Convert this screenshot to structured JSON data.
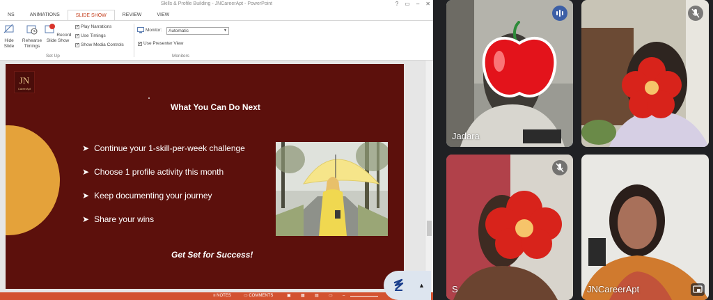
{
  "ppt": {
    "title": "Skills & Profile Building - JNCareerApt - PowerPoint",
    "tabs": [
      {
        "label": "NS"
      },
      {
        "label": "ANIMATIONS"
      },
      {
        "label": "SLIDE SHOW",
        "active": true
      },
      {
        "label": "REVIEW"
      },
      {
        "label": "VIEW"
      }
    ],
    "ribbon": {
      "hide_slide": "Hide Slide",
      "rehearse_timings": "Rehearse Timings",
      "record_slide_show": "Record Slide Show",
      "play_narrations": "Play Narrations",
      "use_timings": "Use Timings",
      "show_media_controls": "Show Media Controls",
      "setup_group": "Set Up",
      "monitor_label": "Monitor:",
      "monitor_value": "Automatic",
      "use_presenter_view": "Use Presenter View",
      "monitors_group": "Monitors"
    },
    "slide": {
      "logo_letters": "JN",
      "logo_text": "CareerApt",
      "title": "What You Can Do Next",
      "bullets": [
        "Continue your 1-skill-per-week challenge",
        "Choose 1 profile activity this month",
        "Keep documenting your journey",
        "Share your wins"
      ],
      "bullet_marker": "➤",
      "tagline": "Get Set for Success!",
      "background": "#5c100c",
      "accent": "#e4a23a"
    },
    "status": {
      "notes": "NOTES",
      "comments": "COMMENTS"
    }
  },
  "meet": {
    "participants": [
      {
        "name": "Jadara",
        "speaking": true,
        "mic": "active"
      },
      {
        "name": "",
        "speaking": false,
        "mic": "muted"
      },
      {
        "name": "S",
        "speaking": false,
        "mic": "muted"
      },
      {
        "name": "JNCareerApt",
        "speaking": false,
        "mic": "presenting"
      }
    ],
    "colors": {
      "speaking_border": "#a8c7fa",
      "background": "#202124"
    }
  }
}
